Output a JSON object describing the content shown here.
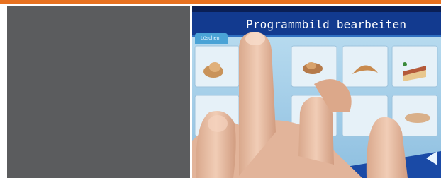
{
  "header": {
    "accent_color": "#e8711f"
  },
  "left_panel": {
    "color": "#5b5c5e"
  },
  "photo": {
    "screen_title": "Programmbild bearbeiten",
    "tab_label": "Löschen",
    "screen_color": "#123a8f",
    "icons": [
      "bread-icon",
      "pastry-icon",
      "croissant-icon",
      "cake-icon",
      "plate-icon"
    ]
  }
}
